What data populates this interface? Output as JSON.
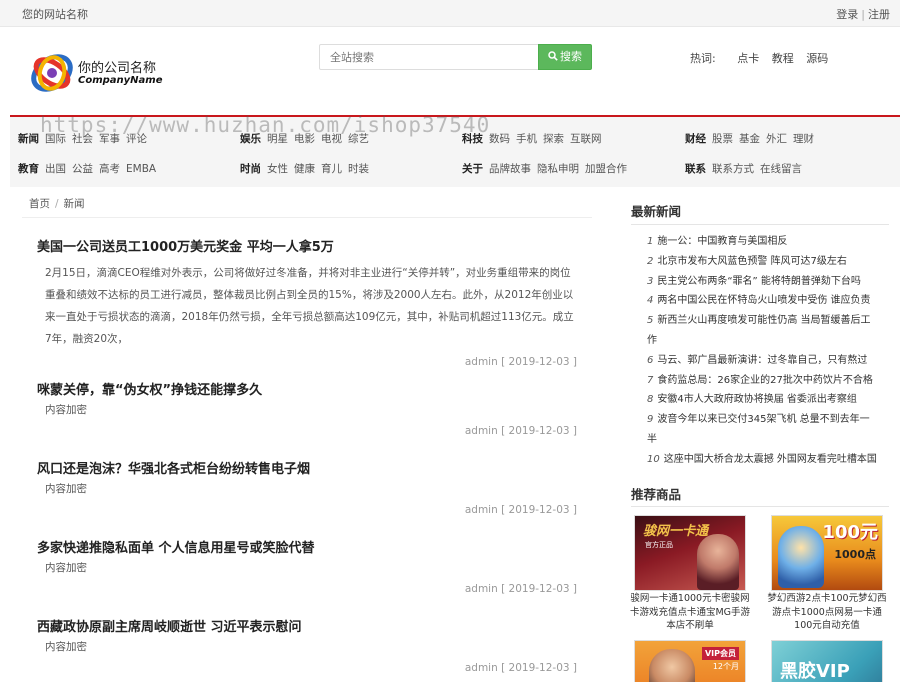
{
  "topbar": {
    "site_name": "您的网站名称",
    "login": "登录",
    "sep": "|",
    "register": "注册"
  },
  "header": {
    "company_name": "你的公司名称",
    "company_name_en": "CompanyName",
    "search_placeholder": "全站搜索",
    "search_button": "搜索",
    "hot_label": "热词:",
    "hot_words": [
      "点卡",
      "教程",
      "源码"
    ]
  },
  "watermark": "https://www.huzhan.com/ishop37540",
  "nav": {
    "rows": [
      [
        {
          "head": "新闻",
          "items": [
            "国际",
            "社会",
            "军事",
            "评论"
          ]
        },
        {
          "head": "娱乐",
          "items": [
            "明星",
            "电影",
            "电视",
            "综艺"
          ]
        },
        {
          "head": "科技",
          "items": [
            "数码",
            "手机",
            "探索",
            "互联网"
          ]
        },
        {
          "head": "财经",
          "items": [
            "股票",
            "基金",
            "外汇",
            "理财"
          ]
        }
      ],
      [
        {
          "head": "教育",
          "items": [
            "出国",
            "公益",
            "高考",
            "EMBA"
          ]
        },
        {
          "head": "时尚",
          "items": [
            "女性",
            "健康",
            "育儿",
            "时装"
          ]
        },
        {
          "head": "关于",
          "items": [
            "品牌故事",
            "隐私申明",
            "加盟合作"
          ]
        },
        {
          "head": "联系",
          "items": [
            "联系方式",
            "在线留言"
          ]
        }
      ]
    ]
  },
  "breadcrumb": {
    "home": "首页",
    "divider": "/",
    "current": "新闻"
  },
  "articles": [
    {
      "title": "美国一公司送员工1000万美元奖金 平均一人拿5万",
      "summary": "2月15日，滴滴CEO程维对外表示，公司将做好过冬准备，并将对非主业进行“关停并转”，对业务重组带来的岗位重叠和绩效不达标的员工进行减员，整体裁员比例占到全员的15%，将涉及2000人左右。此外，从2012年创业以来一直处于亏损状态的滴滴，2018年仍然亏损，全年亏损总额高达109亿元，其中，补贴司机超过113亿元。成立7年，融资20次，",
      "meta": "admin [ 2019-12-03 ]"
    },
    {
      "title": "咪蒙关停，靠“伪女权”挣钱还能撑多久",
      "summary": "内容加密",
      "meta": "admin [ 2019-12-03 ]"
    },
    {
      "title": "风口还是泡沫？华强北各式柜台纷纷转售电子烟",
      "summary": "内容加密",
      "meta": "admin [ 2019-12-03 ]"
    },
    {
      "title": "多家快递推隐私面单 个人信息用星号或笑脸代替",
      "summary": "内容加密",
      "meta": "admin [ 2019-12-03 ]"
    },
    {
      "title": "西藏政协原副主席周岐顺逝世 习近平表示慰问",
      "summary": "内容加密",
      "meta": "admin [ 2019-12-03 ]"
    }
  ],
  "sidebar": {
    "latest_title": "最新新闻",
    "latest": [
      {
        "n": "1",
        "text": "施一公：中国教育与美国相反"
      },
      {
        "n": "2",
        "text": "北京市发布大风蓝色预警 阵风可达7级左右"
      },
      {
        "n": "3",
        "text": "民主党公布两条“罪名” 能将特朗普弹劾下台吗"
      },
      {
        "n": "4",
        "text": "两名中国公民在怀特岛火山喷发中受伤 谁应负责"
      },
      {
        "n": "5",
        "text": "新西兰火山再度喷发可能性仍高 当局暂缓善后工作"
      },
      {
        "n": "6",
        "text": "马云、郭广昌最新演讲：过冬靠自己，只有熬过"
      },
      {
        "n": "7",
        "text": "食药监总局：26家企业的27批次中药饮片不合格"
      },
      {
        "n": "8",
        "text": "安徽4市人大政府政协将换届 省委派出考察组"
      },
      {
        "n": "9",
        "text": "波音今年以来已交付345架飞机 总量不到去年一半"
      },
      {
        "n": "10",
        "text": "这座中国大桥合龙太震撼 外国网友看完吐槽本国"
      }
    ],
    "products_title": "推荐商品",
    "products": [
      {
        "caption": "骏网一卡通1000元卡密骏网卡游戏充值点卡通宝MG手游本店不刷单",
        "img_text": "骏网一卡通",
        "img_sub": "官方正品"
      },
      {
        "caption": "梦幻西游2点卡100元梦幻西游点卡1000点网易一卡通100元自动充值",
        "img_text": "100元",
        "img_sub": "1000点"
      },
      {
        "caption": "",
        "img_text": "VIP会员",
        "img_sub": "12个月"
      },
      {
        "caption": "",
        "img_text": "黑胶VIP",
        "img_sub": ""
      }
    ]
  },
  "colors": {
    "accent_red": "#c9171c",
    "search_green": "#5cb85c"
  }
}
